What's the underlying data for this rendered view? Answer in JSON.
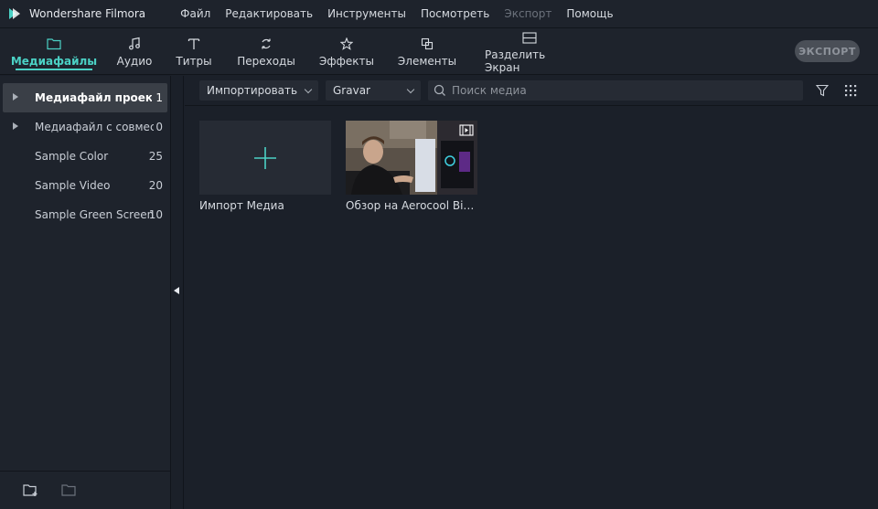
{
  "app": {
    "title": "Wondershare Filmora"
  },
  "menu": [
    {
      "label": "Файл",
      "disabled": false
    },
    {
      "label": "Редактировать",
      "disabled": false
    },
    {
      "label": "Инструменты",
      "disabled": false
    },
    {
      "label": "Посмотреть",
      "disabled": false
    },
    {
      "label": "Экспорт",
      "disabled": true
    },
    {
      "label": "Помощь",
      "disabled": false
    }
  ],
  "tabs": [
    {
      "label": "Медиафайлы",
      "icon": "folder-icon",
      "active": true
    },
    {
      "label": "Аудио",
      "icon": "music-note-icon",
      "active": false
    },
    {
      "label": "Титры",
      "icon": "text-icon",
      "active": false
    },
    {
      "label": "Переходы",
      "icon": "transition-icon",
      "active": false
    },
    {
      "label": "Эффекты",
      "icon": "effects-star-icon",
      "active": false
    },
    {
      "label": "Элементы",
      "icon": "elements-icon",
      "active": false
    },
    {
      "label": "Разделить Экран",
      "icon": "split-screen-icon",
      "active": false
    }
  ],
  "export_button": "ЭКСПОРТ",
  "sidebar": {
    "items": [
      {
        "label": "Медиафайл проекта",
        "count": "1",
        "expandable": true,
        "selected": true
      },
      {
        "label": "Медиафайл с совместн",
        "count": "0",
        "expandable": true,
        "selected": false
      },
      {
        "label": "Sample Color",
        "count": "25",
        "expandable": false,
        "selected": false
      },
      {
        "label": "Sample Video",
        "count": "20",
        "expandable": false,
        "selected": false
      },
      {
        "label": "Sample Green Screen",
        "count": "10",
        "expandable": false,
        "selected": false
      }
    ]
  },
  "media_toolbar": {
    "import_dropdown": "Импортировать",
    "record_dropdown": "Gravar",
    "search_placeholder": "Поиск медиа"
  },
  "media_items": [
    {
      "label": "Импорт Медиа",
      "type": "import"
    },
    {
      "label": "Обзор на Aerocool Bionic",
      "type": "video"
    }
  ],
  "colors": {
    "accent": "#4bd1c5",
    "background": "#1b2029",
    "panel": "#1e232c"
  }
}
